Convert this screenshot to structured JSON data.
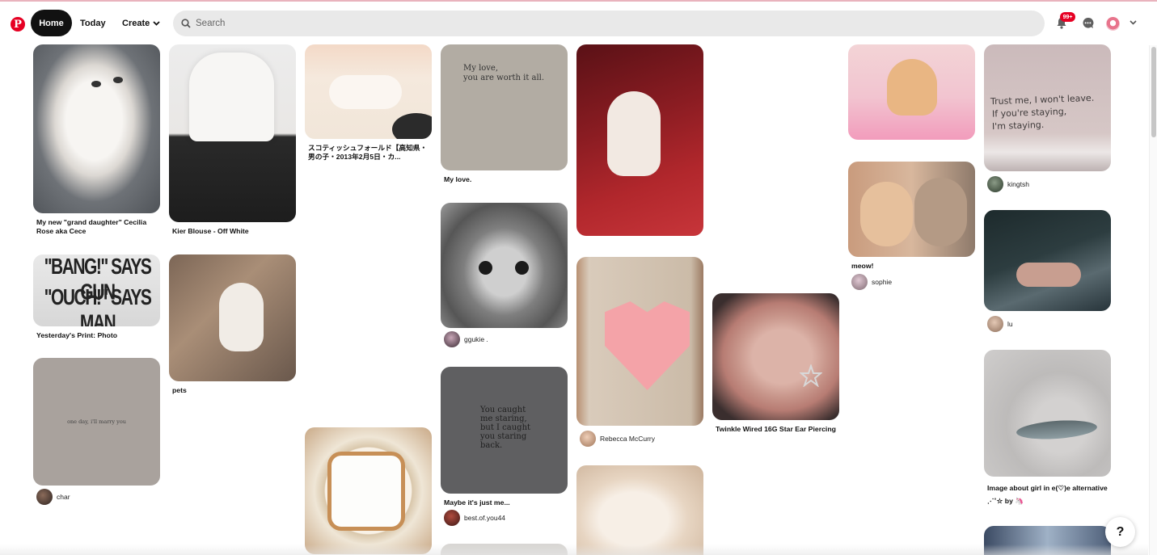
{
  "header": {
    "logo_icon": "pinterest-logo-icon",
    "nav": {
      "home": "Home",
      "today": "Today",
      "create": "Create"
    },
    "search": {
      "placeholder": "Search"
    },
    "notifications_badge": "99+",
    "icons": [
      "bell-icon",
      "chat-icon",
      "chevron-down-icon"
    ]
  },
  "pins": [
    {
      "id": "c1p1",
      "title": "My new \"grand daughter\" Cecilia Rose aka Cece"
    },
    {
      "id": "c1p2",
      "title": "Yesterday's Print: Photo",
      "image_text": [
        "\"BANG!\" SAYS GUN",
        "\"OUCH!\" SAYS MAN"
      ]
    },
    {
      "id": "c1p3",
      "user": "char",
      "image_text": "one day, i'll marry you"
    },
    {
      "id": "c2p1",
      "title": "Kier Blouse - Off White"
    },
    {
      "id": "c2p2",
      "title": "pets"
    },
    {
      "id": "c3p1",
      "title": "スコティッシュフォールド【高知県・男の子・2013年2月5日・カ..."
    },
    {
      "id": "c3p2"
    },
    {
      "id": "c4p1",
      "title": "My love.",
      "image_text": [
        "My love,",
        "you are worth it all."
      ]
    },
    {
      "id": "c4p2",
      "user": "ggukie ."
    },
    {
      "id": "c4p3",
      "title": "Maybe it's just me...",
      "user": "best.of.you44",
      "image_text": [
        "You caught",
        "me staring,",
        "but I caught",
        "you staring",
        "back."
      ]
    },
    {
      "id": "c5p1"
    },
    {
      "id": "c5p2",
      "user": "Rebecca McCurry"
    },
    {
      "id": "c5p3"
    },
    {
      "id": "c6p1",
      "title": "Twinkle Wired 16G Star Ear Piercing"
    },
    {
      "id": "c7p1"
    },
    {
      "id": "c7p2",
      "title": "meow!",
      "user": "sophie"
    },
    {
      "id": "c8p1",
      "user": "kingtsh",
      "image_text": [
        "Trust me, I won't leave.",
        "If you're staying,",
        "I'm staying."
      ]
    },
    {
      "id": "c8p2",
      "user": "lu"
    },
    {
      "id": "c8p3",
      "title": "Image about girl in e(♡)e alternative ⋰˚☆ by 🦄"
    },
    {
      "id": "c8p4"
    }
  ],
  "help_label": "?",
  "colors": {
    "brand": "#e60023",
    "nav_active_bg": "#111111",
    "search_bg": "#e9e9e9"
  }
}
